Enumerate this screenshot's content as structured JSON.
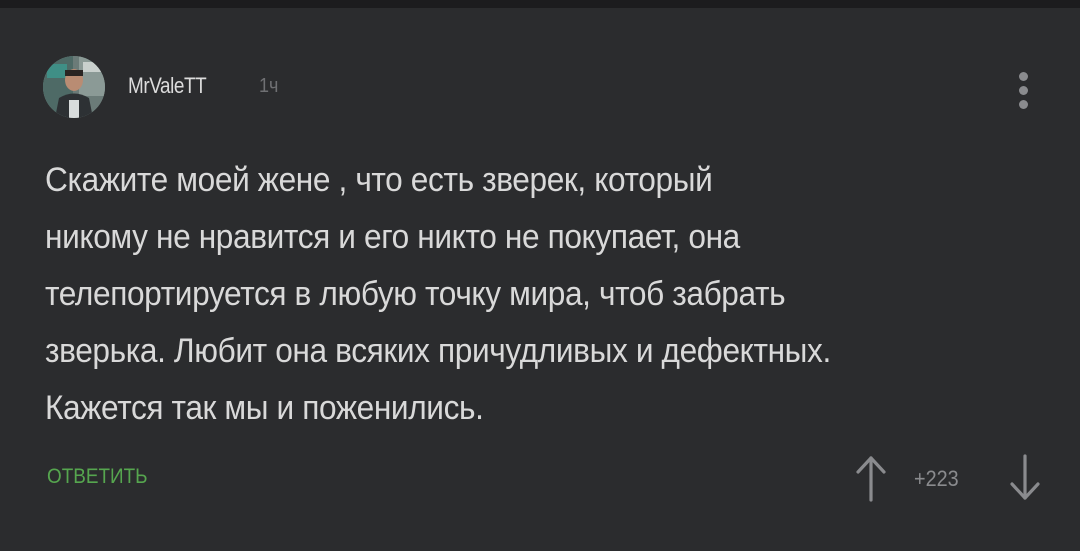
{
  "comment": {
    "author": "MrValeTT",
    "time": "1ч",
    "text_lines": [
      "Скажите моей жене , что есть зверек, который",
      "никому не нравится и его никто не покупает, она",
      "телепортируется в любую точку мира, чтоб забрать",
      "зверька. Любит она всяких причудливых и дефектных.",
      "Кажется так мы и поженились."
    ],
    "reply_label": "ОТВЕТИТЬ",
    "rating": "+223",
    "icons": {
      "menu": "more-vertical-icon",
      "upvote": "arrow-up-icon",
      "downvote": "arrow-down-icon"
    }
  },
  "colors": {
    "background": "#2b2c2e",
    "text": "#d9d9d9",
    "muted": "#8a8b8e",
    "accent_green": "#56a64f"
  }
}
